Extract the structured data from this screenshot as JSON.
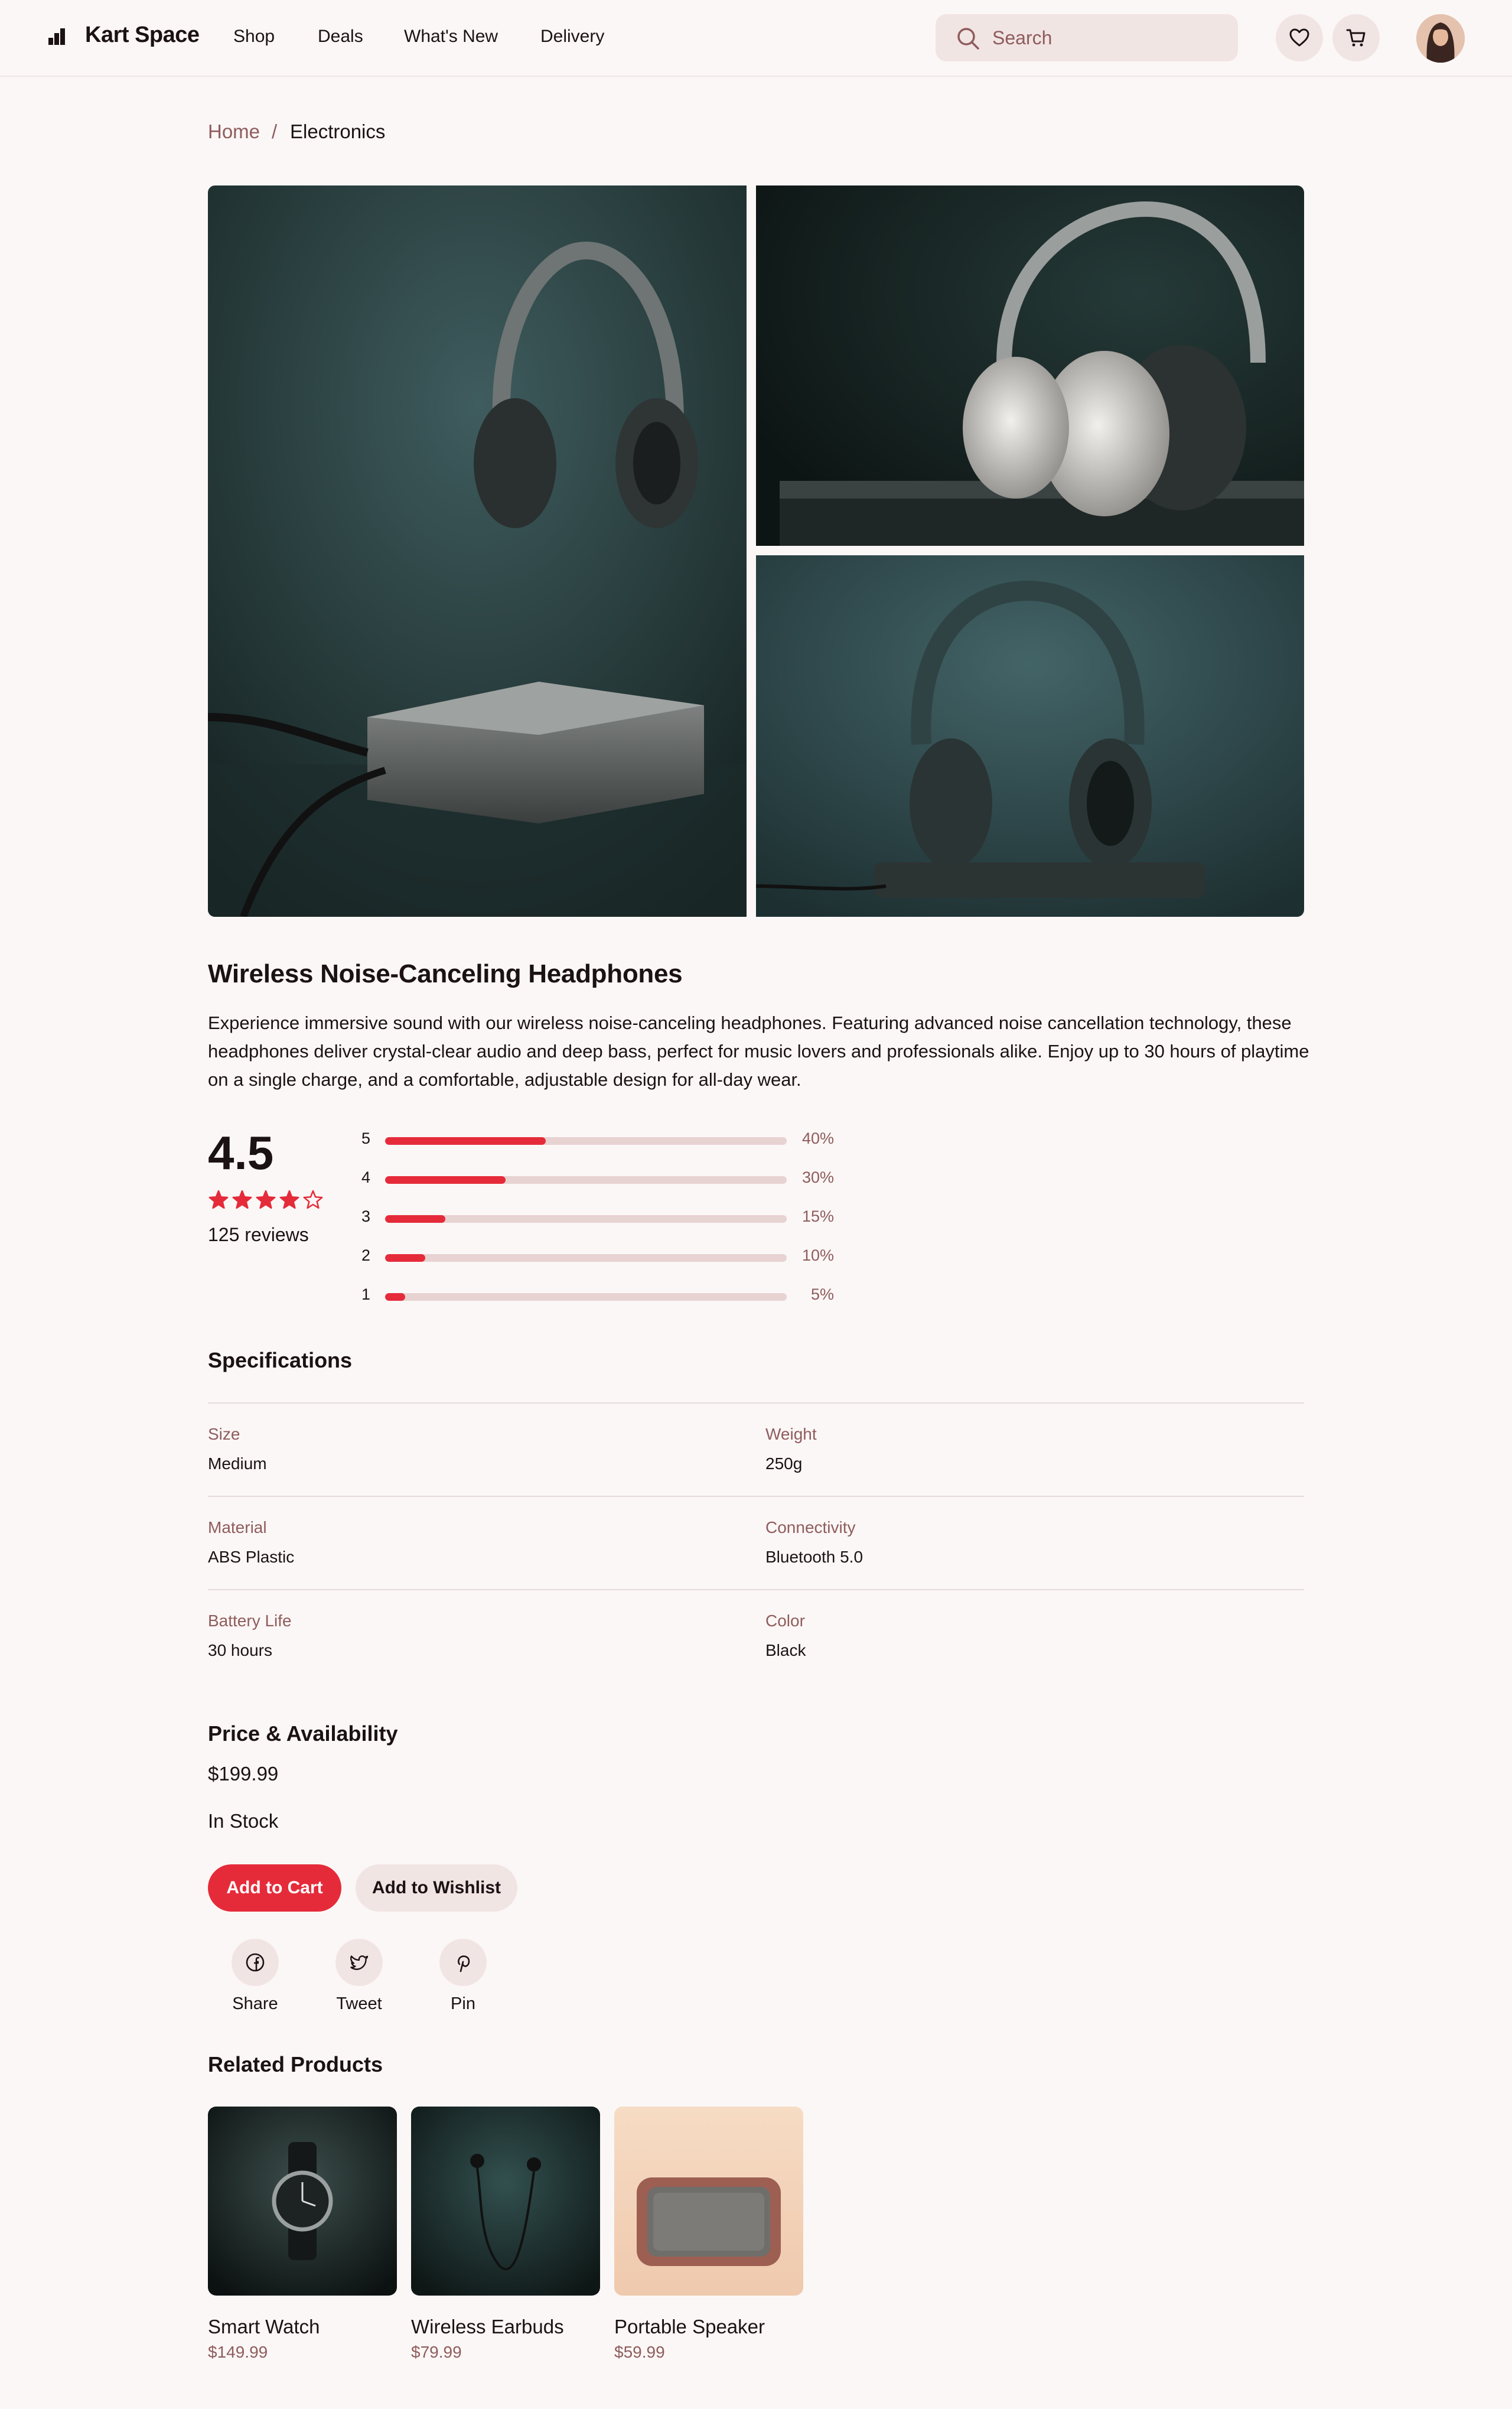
{
  "header": {
    "brand": "Kart Space",
    "nav": [
      "Shop",
      "Deals",
      "What's New",
      "Delivery"
    ],
    "search_placeholder": "Search",
    "icons": [
      "heart-icon",
      "cart-icon"
    ]
  },
  "breadcrumb": {
    "home": "Home",
    "separator": "/",
    "current": "Electronics"
  },
  "product": {
    "title": "Wireless Noise-Canceling Headphones",
    "description": "Experience immersive sound with our wireless noise-canceling headphones. Featuring advanced noise cancellation technology, these headphones deliver crystal-clear audio and deep bass, perfect for music lovers and professionals alike. Enjoy up to 30 hours of playtime on a single charge, and a comfortable, adjustable design for all-day wear."
  },
  "rating": {
    "average": "4.5",
    "stars_value": 4,
    "stars_total": 5,
    "reviews": "125 reviews",
    "breakdown": [
      {
        "stars": "5",
        "percent_label": "40%",
        "fraction": 0.4
      },
      {
        "stars": "4",
        "percent_label": "30%",
        "fraction": 0.3
      },
      {
        "stars": "3",
        "percent_label": "15%",
        "fraction": 0.15
      },
      {
        "stars": "2",
        "percent_label": "10%",
        "fraction": 0.1
      },
      {
        "stars": "1",
        "percent_label": "5%",
        "fraction": 0.05
      }
    ]
  },
  "specs": {
    "heading": "Specifications",
    "items": [
      {
        "label": "Size",
        "value": "Medium"
      },
      {
        "label": "Weight",
        "value": "250g"
      },
      {
        "label": "Material",
        "value": "ABS Plastic"
      },
      {
        "label": "Connectivity",
        "value": "Bluetooth 5.0"
      },
      {
        "label": "Battery Life",
        "value": "30 hours"
      },
      {
        "label": "Color",
        "value": "Black"
      }
    ]
  },
  "availability": {
    "heading": "Price & Availability",
    "price": "$199.99",
    "stock": "In Stock",
    "add_to_cart": "Add to Cart",
    "add_to_wishlist": "Add to Wishlist"
  },
  "share": [
    {
      "label": "Share",
      "icon": "facebook-icon"
    },
    {
      "label": "Tweet",
      "icon": "twitter-icon"
    },
    {
      "label": "Pin",
      "icon": "pinterest-icon"
    }
  ],
  "related": {
    "heading": "Related Products",
    "items": [
      {
        "name": "Smart Watch",
        "price": "$149.99"
      },
      {
        "name": "Wireless Earbuds",
        "price": "$79.99"
      },
      {
        "name": "Portable Speaker",
        "price": "$59.99"
      }
    ]
  },
  "colors": {
    "accent": "#e52b3a",
    "muted": "#8f5c5c",
    "chip": "#f1e5e4",
    "background": "#fbf7f6"
  }
}
